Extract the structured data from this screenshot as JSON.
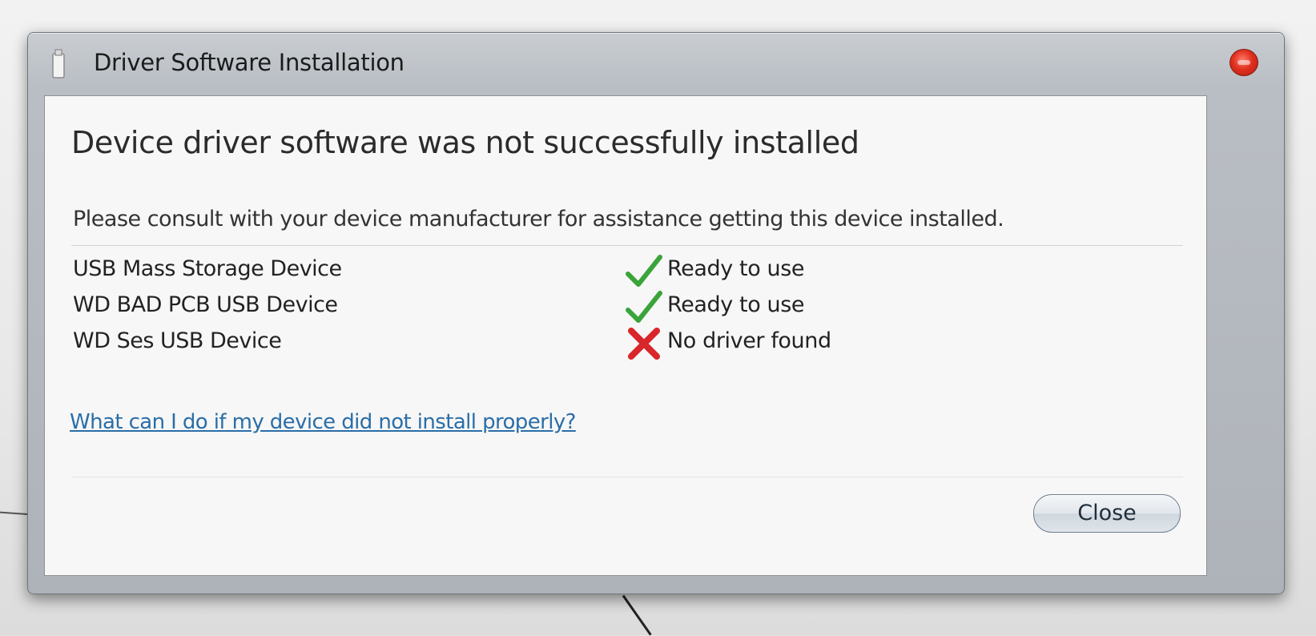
{
  "window": {
    "title": "Driver Software Installation",
    "close_control": "close-window",
    "icon": "usb-device-icon"
  },
  "main": {
    "heading": "Device driver software was not successfully installed",
    "message": "Please consult with your device manufacturer for assistance getting this device installed.",
    "devices": [
      {
        "name": "USB Mass Storage Device",
        "status": "Ready to use",
        "status_icon": "checkmark-icon",
        "status_color": "#3aa43a"
      },
      {
        "name": "WD BAD PCB USB Device",
        "status": "Ready to use",
        "status_icon": "checkmark-icon",
        "status_color": "#3aa43a"
      },
      {
        "name": "WD Ses USB Device",
        "status": "No driver found",
        "status_icon": "error-x-icon",
        "status_color": "#d9262a"
      }
    ],
    "help_link": "What can I do if my device did not install properly?"
  },
  "footer": {
    "close_label": "Close"
  },
  "colors": {
    "link": "#2a6ea8",
    "close_control": "#e0301f"
  }
}
